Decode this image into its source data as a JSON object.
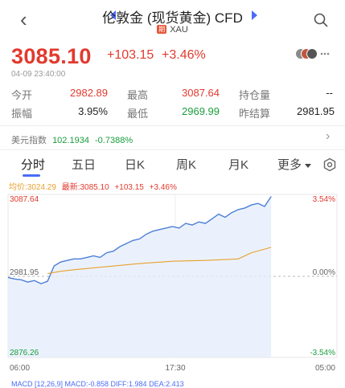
{
  "header": {
    "title": "伦敦金 (现货黄金) CFD",
    "tag": "期",
    "symbol": "XAU"
  },
  "quote": {
    "price": "3085.10",
    "change": "+103.15",
    "change_pct": "+3.46%",
    "datetime": "04-09 23:40:00"
  },
  "stats": {
    "row1": [
      {
        "label": "今开",
        "value": "2982.89",
        "color": "#e23a2e"
      },
      {
        "label": "最高",
        "value": "3087.64",
        "color": "#e23a2e"
      },
      {
        "label": "持仓量",
        "value": "--",
        "color": "#222222"
      }
    ],
    "row2": [
      {
        "label": "振幅",
        "value": "3.95%",
        "color": "#222222"
      },
      {
        "label": "最低",
        "value": "2969.99",
        "color": "#1a9e3c"
      },
      {
        "label": "昨结算",
        "value": "2981.95",
        "color": "#222222"
      }
    ]
  },
  "usd_index": {
    "label": "美元指数",
    "value": "102.1934",
    "change": "-0.7388%"
  },
  "tabs": [
    "分时",
    "五日",
    "日K",
    "周K",
    "月K",
    "更多"
  ],
  "legend": {
    "avg": "均价:3024.29",
    "latest": "最新:3085.10",
    "change": "+103.15",
    "pct": "+3.46%"
  },
  "chart_data": {
    "type": "line",
    "y_left_ticks": [
      "3087.64",
      "2981.95",
      "2876.26"
    ],
    "y_right_ticks": [
      "3.54%",
      "0.00%",
      "-3.54%"
    ],
    "x_ticks": [
      "06:00",
      "17:30",
      "05:00"
    ],
    "ylim": [
      2876.26,
      3087.64
    ],
    "series": [
      {
        "name": "最新",
        "color": "#4a7fd6",
        "x": [
          0,
          0.02,
          0.04,
          0.06,
          0.08,
          0.1,
          0.12,
          0.14,
          0.16,
          0.18,
          0.2,
          0.22,
          0.24,
          0.26,
          0.28,
          0.3,
          0.32,
          0.34,
          0.36,
          0.38,
          0.4,
          0.42,
          0.44,
          0.46,
          0.48,
          0.5,
          0.52,
          0.54,
          0.56,
          0.58,
          0.6,
          0.62,
          0.64,
          0.66,
          0.68,
          0.7,
          0.72,
          0.74,
          0.76,
          0.78,
          0.8
        ],
        "values": [
          2980,
          2978,
          2977,
          2974,
          2976,
          2972,
          2975,
          2995,
          3000,
          3002,
          3004,
          3004,
          3006,
          3008,
          3006,
          3012,
          3014,
          3020,
          3024,
          3028,
          3030,
          3036,
          3040,
          3042,
          3044,
          3046,
          3044,
          3050,
          3048,
          3052,
          3050,
          3056,
          3062,
          3058,
          3064,
          3068,
          3070,
          3074,
          3076,
          3072,
          3085
        ]
      },
      {
        "name": "均价",
        "color": "#e8a030",
        "x": [
          0.12,
          0.16,
          0.2,
          0.3,
          0.4,
          0.5,
          0.6,
          0.7,
          0.74,
          0.8
        ],
        "values": [
          2985,
          2988,
          2990,
          2994,
          2998,
          3001,
          3002,
          3004,
          3012,
          3019
        ]
      }
    ]
  },
  "indicator": {
    "text": "MACD  [12,26,9]  MACD:-0.858  DIFF:1.984  DEA:2.413"
  },
  "colors": {
    "up": "#e23a2e",
    "down": "#1a9e3c",
    "accent": "#4a6cf7",
    "avg_line": "#e8a030",
    "price_line": "#4a7fd6"
  }
}
